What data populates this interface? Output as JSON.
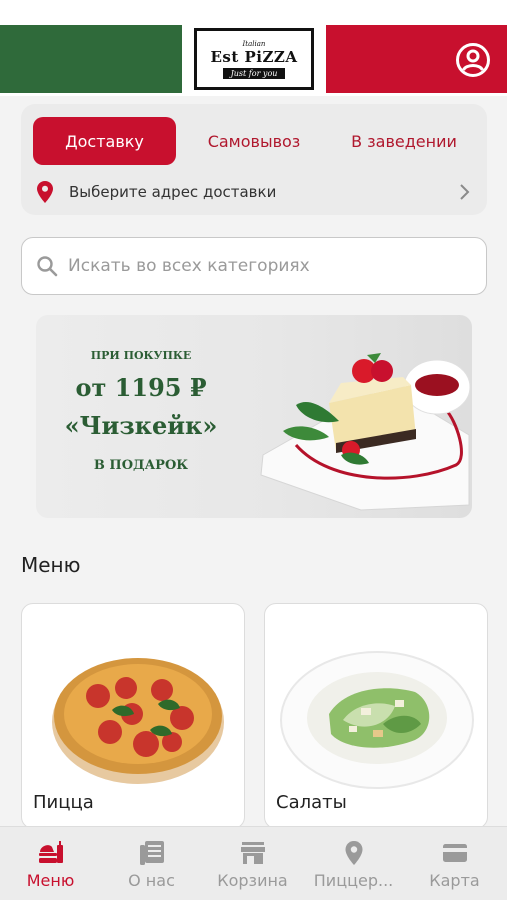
{
  "header": {
    "logo": {
      "top": "Italian",
      "name": "Est PiZZA",
      "tagline": "Just for you"
    },
    "colors": {
      "green": "#2f6a3a",
      "red": "#c8102e"
    },
    "account_icon": "user-circle-icon"
  },
  "delivery": {
    "tabs": [
      {
        "label": "Доставку",
        "active": true
      },
      {
        "label": "Самовывоз",
        "active": false
      },
      {
        "label": "В заведении",
        "active": false
      }
    ],
    "address_placeholder": "Выберите адрес доставки"
  },
  "search": {
    "placeholder": "Искать во всех категориях",
    "value": ""
  },
  "banner": {
    "line1": "ПРИ ПОКУПКЕ",
    "line2": "от 1195 ₽",
    "line3": "«Чизкейк»",
    "line4": "В ПОДАРОК"
  },
  "menu": {
    "title": "Меню",
    "categories": [
      {
        "label": "Пицца"
      },
      {
        "label": "Салаты"
      }
    ]
  },
  "bottom_nav": {
    "items": [
      {
        "label": "Меню",
        "icon": "menu-food-icon",
        "active": true
      },
      {
        "label": "О нас",
        "icon": "newspaper-icon",
        "active": false
      },
      {
        "label": "Корзина",
        "icon": "store-icon",
        "active": false
      },
      {
        "label": "Пиццер...",
        "icon": "location-pin-icon",
        "active": false
      },
      {
        "label": "Карта",
        "icon": "card-icon",
        "active": false
      }
    ]
  },
  "accent_color": "#c8102e"
}
